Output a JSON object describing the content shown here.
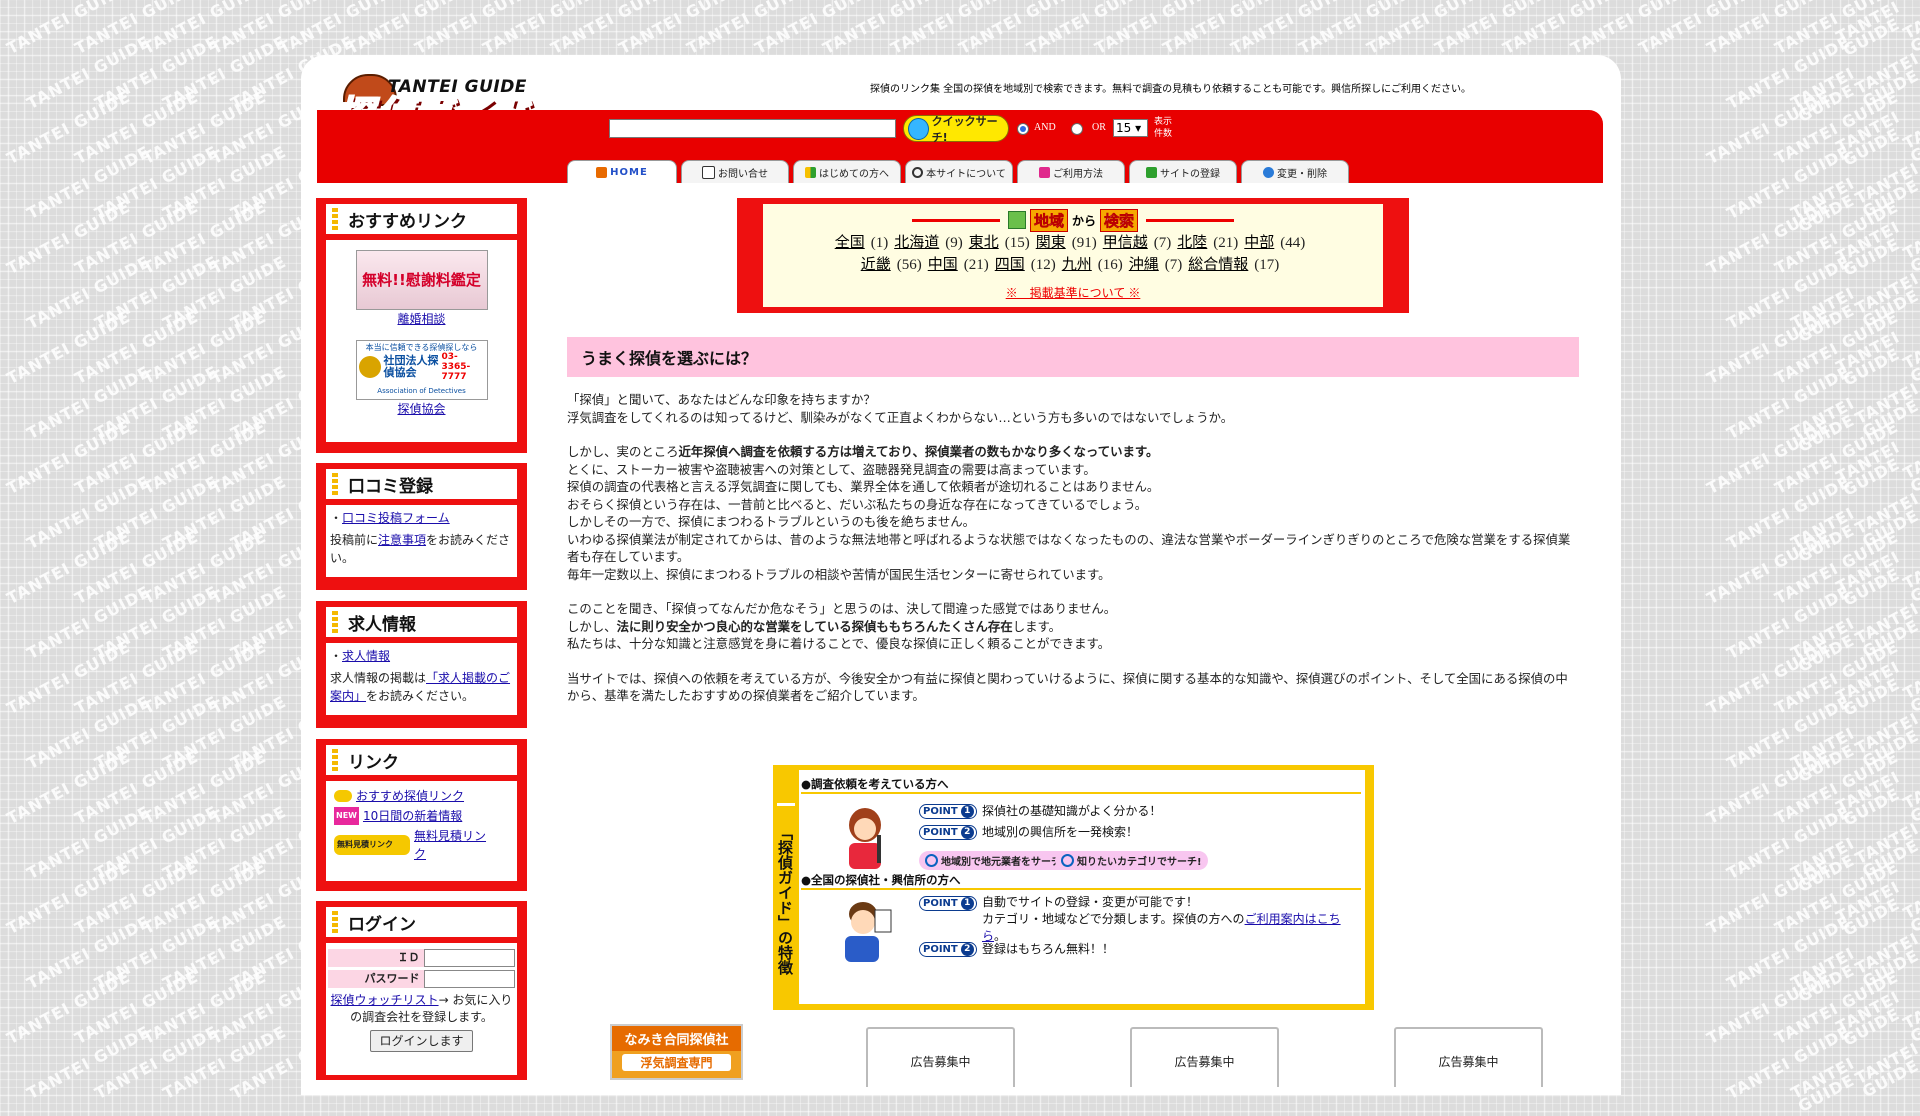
{
  "colors": {
    "accent_red": "#e80000",
    "pink_header": "#ffc3de",
    "yellow": "#f8c800",
    "link_blue": "#1a0dab"
  },
  "background_watermark": "TANTEI GUIDE",
  "header": {
    "logo_en": "TANTEI GUIDE",
    "logo_jp": "探偵ガイド",
    "tagline": "探偵のリンク集 全国の探偵を地域別で検索できます。無料で調査の見積もり依頼することも可能です。興信所探しにご利用ください。",
    "search": {
      "value": "",
      "button_label": "クイックサーチ!",
      "and_label": "AND",
      "or_label": "OR",
      "count_value": "15",
      "count_label": "表示件数"
    },
    "tabs": [
      {
        "label": "HOME",
        "icon": "home-icon"
      },
      {
        "label": "お問い合せ",
        "icon": "mail-icon"
      },
      {
        "label": "はじめての方へ",
        "icon": "beginner-icon"
      },
      {
        "label": "本サイトについて",
        "icon": "magnifier-icon"
      },
      {
        "label": "ご利用方法",
        "icon": "note-icon"
      },
      {
        "label": "サイトの登録",
        "icon": "pencil-icon"
      },
      {
        "label": "変更・削除",
        "icon": "refresh-icon"
      }
    ]
  },
  "sidebar": {
    "recommended": {
      "title": "おすすめリンク",
      "banner1_text": "無料!!慰謝料鑑定",
      "banner1_link": "離婚相談",
      "banner2_text_top": "本当に信頼できる探偵探しなら",
      "banner2_org": "社団法人探偵協会",
      "banner2_phone": "03-3365-7777",
      "banner2_en": "Association of Detectives",
      "banner2_link": "探偵協会"
    },
    "review": {
      "title": "口コミ登録",
      "link": "口コミ投稿フォーム",
      "note_pre": "投稿前に",
      "note_link": "注意事項",
      "note_post": "をお読みください。"
    },
    "jobs": {
      "title": "求人情報",
      "link": "求人情報",
      "note_pre": "求人情報の掲載は",
      "note_link": "「求人掲載のご案内」",
      "note_post": "をお読みください。"
    },
    "links": {
      "title": "リンク",
      "items": [
        {
          "label": "おすすめ探偵リンク",
          "badge": ""
        },
        {
          "label": "10日間の新着情報",
          "badge": "NEW"
        },
        {
          "label": "無料見積リンク",
          "badge": "無料見積リンク"
        }
      ]
    },
    "login": {
      "title": "ログイン",
      "id_label": "ＩＤ",
      "pw_label": "パスワード",
      "watch_link": "探偵ウォッチリスト",
      "watch_text": "→ お気に入りの調査会社を登録します。",
      "button": "ログインします"
    }
  },
  "region": {
    "head_1": "地域",
    "head_2": "から",
    "head_3": "検索",
    "row1": [
      {
        "name": "全国",
        "count": "(1)"
      },
      {
        "name": "北海道",
        "count": "(9)"
      },
      {
        "name": "東北",
        "count": "(15)"
      },
      {
        "name": "関東",
        "count": "(91)"
      },
      {
        "name": "甲信越",
        "count": "(7)"
      },
      {
        "name": "北陸",
        "count": "(21)"
      },
      {
        "name": "中部",
        "count": "(44)"
      }
    ],
    "row2": [
      {
        "name": "近畿",
        "count": "(56)"
      },
      {
        "name": "中国",
        "count": "(21)"
      },
      {
        "name": "四国",
        "count": "(12)"
      },
      {
        "name": "九州",
        "count": "(16)"
      },
      {
        "name": "沖縄",
        "count": "(7)"
      },
      {
        "name": "総合情報",
        "count": "(17)"
      }
    ],
    "criteria": "※　掲載基準について ※"
  },
  "article": {
    "heading": "うまく探偵を選ぶには？",
    "p1_l1": "「探偵」と聞いて、あなたはどんな印象を持ちますか？",
    "p1_l2": "浮気調査をしてくれるのは知ってるけど、馴染みがなくて正直よくわからない…という方も多いのではないでしょうか。",
    "p2_l1_pre": "しかし、実のところ",
    "p2_l1_bold": "近年探偵へ調査を依頼する方は増えており、探偵業者の数もかなり多くなっています。",
    "p2_l2": "とくに、ストーカー被害や盗聴被害への対策として、盗聴器発見調査の需要は高まっています。",
    "p2_l3": "探偵の調査の代表格と言える浮気調査に関しても、業界全体を通して依頼者が途切れることはありません。",
    "p2_l4": "おそらく探偵という存在は、一昔前と比べると、だいぶ私たちの身近な存在になってきているでしょう。",
    "p2_l5": "しかしその一方で、探偵にまつわるトラブルというのも後を絶ちません。",
    "p2_l6": "いわゆる探偵業法が制定されてからは、昔のような無法地帯と呼ばれるような状態ではなくなったものの、違法な営業やボーダーラインぎりぎりのところで危険な営業をする探偵業者も存在しています。",
    "p2_l7": "毎年一定数以上、探偵にまつわるトラブルの相談や苦情が国民生活センターに寄せられています。",
    "p3_l1": "このことを聞き、「探偵ってなんだか危なそう」と思うのは、決して間違った感覚ではありません。",
    "p3_l2_pre": "しかし、",
    "p3_l2_bold": "法に則り安全かつ良心的な営業をしている探偵ももちろんたくさん存在",
    "p3_l2_post": "します。",
    "p3_l3": "私たちは、十分な知識と注意感覚を身に着けることで、優良な探偵に正しく頼ることができます。",
    "p4": "当サイトでは、探偵への依頼を考えている方が、今後安全かつ有益に探偵と関わっていけるように、探偵に関する基本的な知識や、探偵選びのポイント、そして全国にある探偵の中から、基準を満たしたおすすめの探偵業者をご紹介しています。"
  },
  "feature": {
    "side_label": "「探偵ガイド」の特徴",
    "section1_title": "●調査依頼を考えている方へ",
    "s1_point1": "探偵社の基礎知識がよく分かる！",
    "s1_point2": "地域別の興信所を一発検索！",
    "pill1": "地域別で地元業者をサーチ!",
    "pill2": "知りたいカテゴリでサーチ!",
    "section2_title": "●全国の探偵社・興信所の方へ",
    "s2_point1_l1": "自動でサイトの登録・変更が可能です！",
    "s2_point1_l2": "カテゴリ・地域などで分類します。探偵の方への",
    "s2_point1_link": "ご利用案内はこちら",
    "s2_point1_end": "。",
    "s2_point2": "登録はもちろん無料！！",
    "point_label": "POINT",
    "n1": "1",
    "n2": "2"
  },
  "ads": {
    "namiki_line1": "なみき合同探偵社",
    "namiki_line2": "浮気調査専門",
    "slots": [
      "広告募集中",
      "広告募集中",
      "広告募集中"
    ]
  }
}
